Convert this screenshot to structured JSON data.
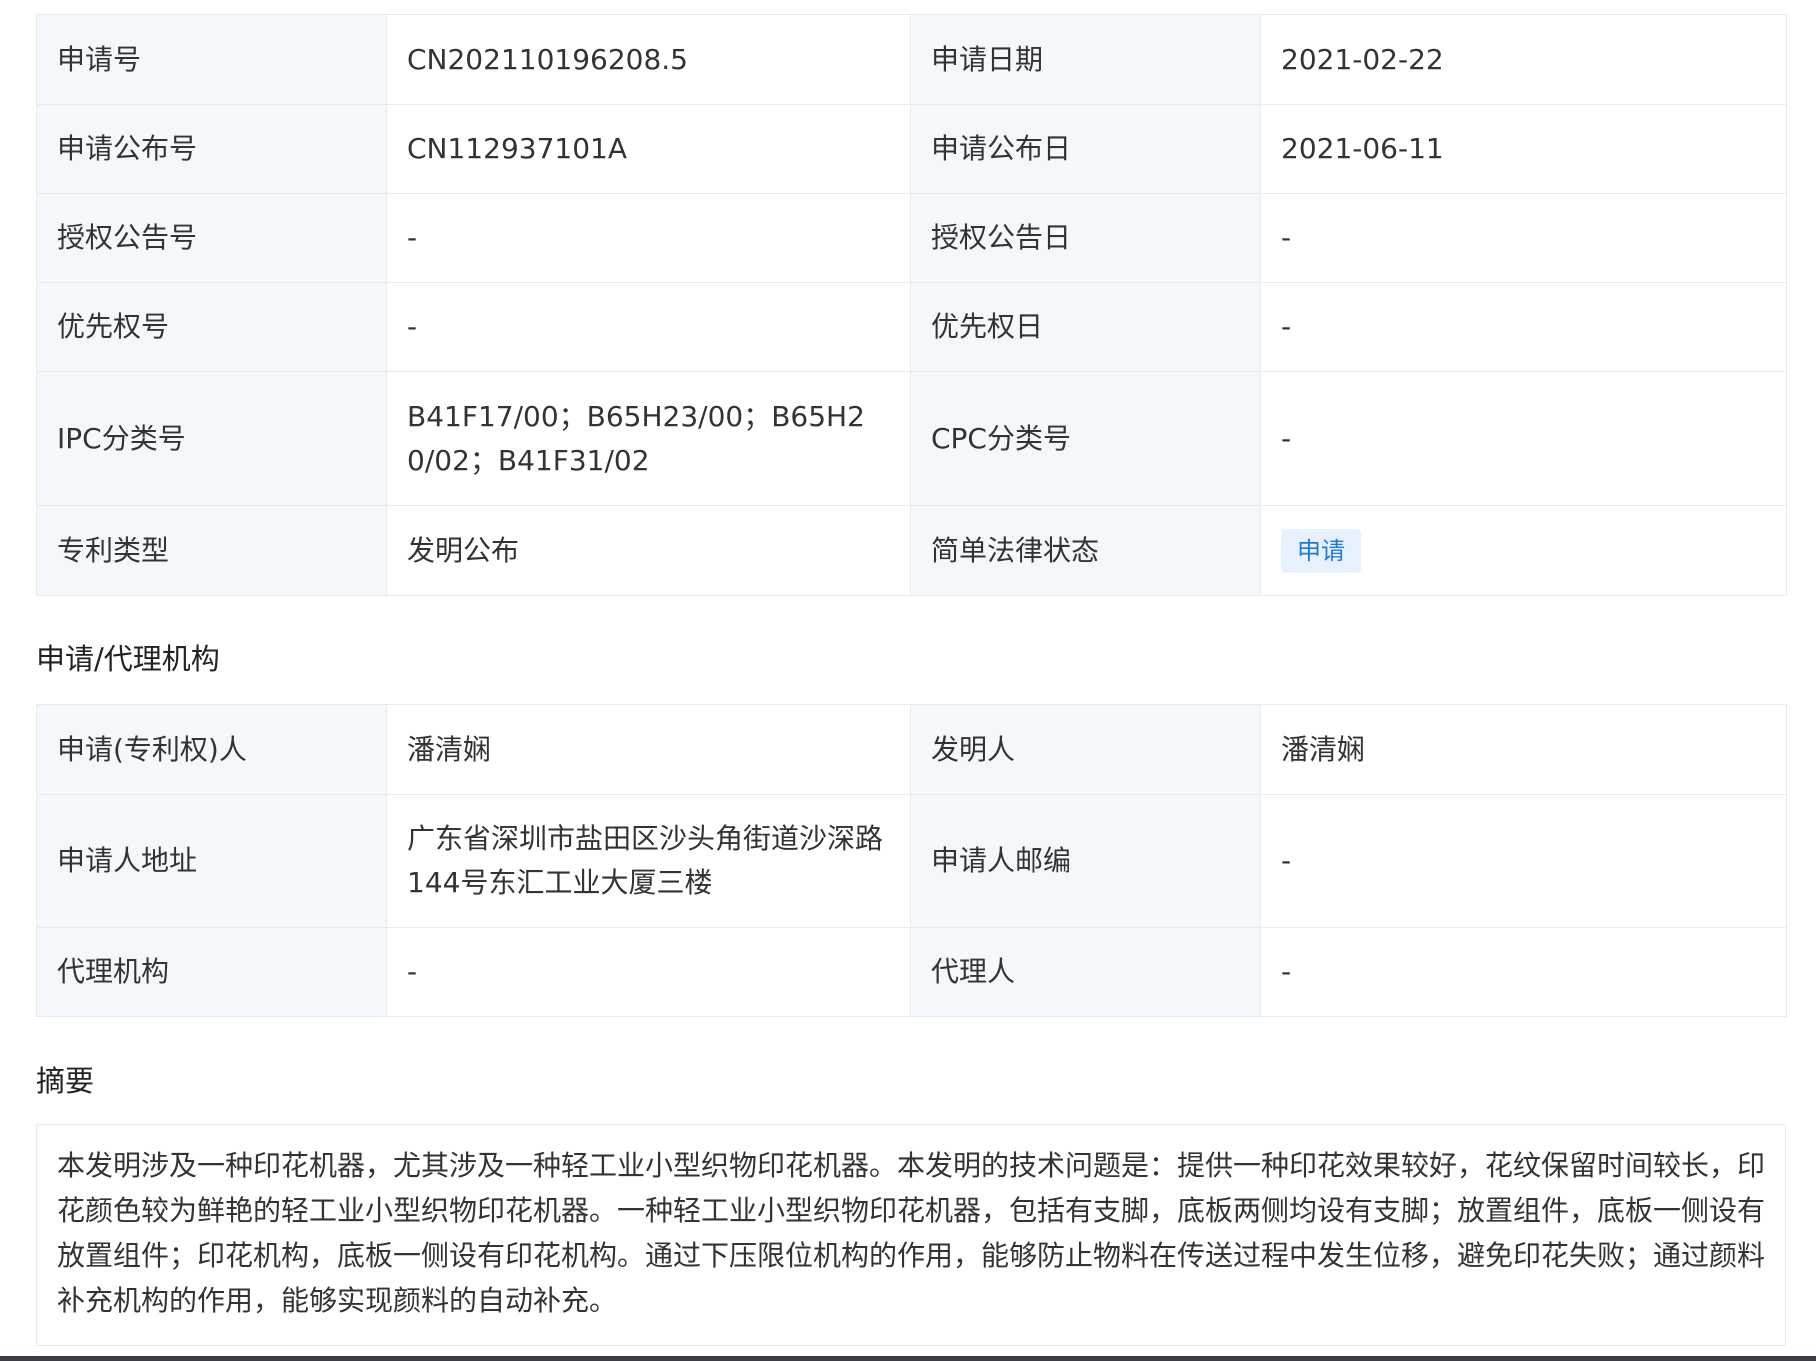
{
  "basic_info": {
    "rows": [
      {
        "k1": "申请号",
        "v1": "CN202110196208.5",
        "k2": "申请日期",
        "v2": "2021-02-22"
      },
      {
        "k1": "申请公布号",
        "v1": "CN112937101A",
        "k2": "申请公布日",
        "v2": "2021-06-11"
      },
      {
        "k1": "授权公告号",
        "v1": "-",
        "k2": "授权公告日",
        "v2": "-"
      },
      {
        "k1": "优先权号",
        "v1": "-",
        "k2": "优先权日",
        "v2": "-"
      },
      {
        "k1": "IPC分类号",
        "v1": "B41F17/00；B65H23/00；B65H20/02；B41F31/02",
        "k2": "CPC分类号",
        "v2": "-"
      },
      {
        "k1": "专利类型",
        "v1": "发明公布",
        "k2": "简单法律状态",
        "v2": "申请"
      }
    ]
  },
  "applicant_section": {
    "title": "申请/代理机构",
    "rows": [
      {
        "k1": "申请(专利权)人",
        "v1": "潘清娴",
        "k2": "发明人",
        "v2": "潘清娴"
      },
      {
        "k1": "申请人地址",
        "v1": "广东省深圳市盐田区沙头角街道沙深路144号东汇工业大厦三楼",
        "k2": "申请人邮编",
        "v2": "-"
      },
      {
        "k1": "代理机构",
        "v1": "-",
        "k2": "代理人",
        "v2": "-"
      }
    ]
  },
  "abstract_section": {
    "title": "摘要",
    "text": "本发明涉及一种印花机器，尤其涉及一种轻工业小型织物印花机器。本发明的技术问题是：提供一种印花效果较好，花纹保留时间较长，印花颜色较为鲜艳的轻工业小型织物印花机器。一种轻工业小型织物印花机器，包括有支脚，底板两侧均设有支脚；放置组件，底板一侧设有放置组件；印花机构，底板一侧设有印花机构。通过下压限位机构的作用，能够防止物料在传送过程中发生位移，避免印花失败；通过颜料补充机构的作用，能够实现颜料的自动补充。"
  },
  "colors": {
    "key_cell_bg": "#f4f8fd",
    "border": "#e6ebf2",
    "status_badge_bg": "#e6f1fd",
    "status_badge_text": "#1f7ad6"
  }
}
